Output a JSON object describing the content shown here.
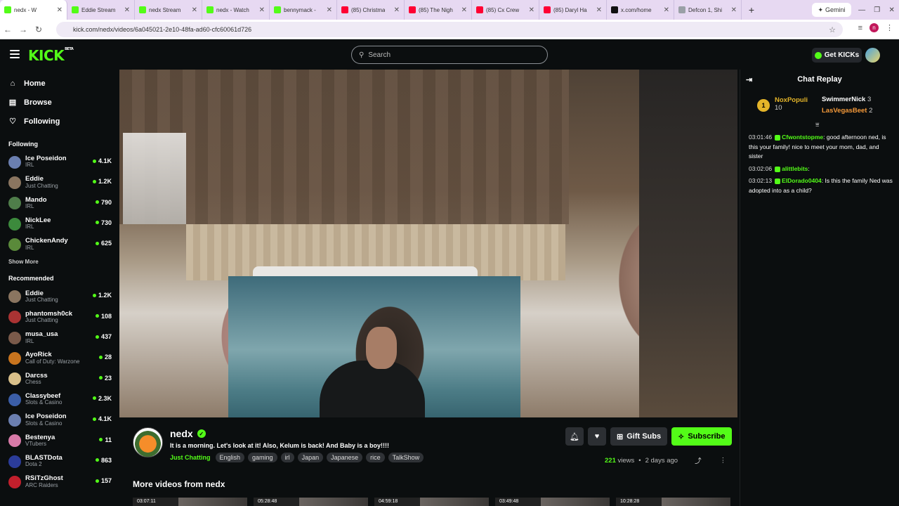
{
  "browser": {
    "tabs": [
      {
        "label": "nedx - W",
        "color": "#53fc18",
        "active": true
      },
      {
        "label": "Eddie Stream",
        "color": "#53fc18"
      },
      {
        "label": "nedx Stream",
        "color": "#53fc18"
      },
      {
        "label": "nedx - Watch",
        "color": "#53fc18"
      },
      {
        "label": "bennymack -",
        "color": "#53fc18"
      },
      {
        "label": "(85) Christma",
        "color": "#ff0033"
      },
      {
        "label": "(85) The Nigh",
        "color": "#ff0033"
      },
      {
        "label": "(85) Cx Crew",
        "color": "#ff0033"
      },
      {
        "label": "(85) Daryl Ha",
        "color": "#ff0033"
      },
      {
        "label": "x.com/home",
        "color": "#111111"
      },
      {
        "label": "Defcon 1, Shi",
        "color": "#9aa0a6"
      }
    ],
    "gemini_label": "Gemini",
    "url": "kick.com/nedx/videos/6a045021-2e10-48fa-ad60-cfc60061d726",
    "profile_initial": "n"
  },
  "header": {
    "logo": "KICK",
    "logo_sup": "BETA",
    "search_placeholder": "Search",
    "get_kicks": "Get KICKs"
  },
  "nav": [
    {
      "label": "Home",
      "icon": "home-icon",
      "glyph": "⌂"
    },
    {
      "label": "Browse",
      "icon": "browse-icon",
      "glyph": "▤"
    },
    {
      "label": "Following",
      "icon": "heart-icon",
      "glyph": "♡"
    }
  ],
  "following_title": "Following",
  "following": [
    {
      "name": "Ice Poseidon",
      "category": "IRL",
      "viewers": "4.1K",
      "color": "#6b7fb0"
    },
    {
      "name": "Eddie",
      "category": "Just Chatting",
      "viewers": "1.2K",
      "color": "#8a7560"
    },
    {
      "name": "Mando",
      "category": "IRL",
      "viewers": "790",
      "color": "#4f7d4a"
    },
    {
      "name": "NickLee",
      "category": "IRL",
      "viewers": "730",
      "color": "#3c8a3c"
    },
    {
      "name": "ChickenAndy",
      "category": "IRL",
      "viewers": "625",
      "color": "#5a8a3a"
    }
  ],
  "show_more": "Show More",
  "recommended_title": "Recommended",
  "recommended": [
    {
      "name": "Eddie",
      "category": "Just Chatting",
      "viewers": "1.2K",
      "color": "#8a7560"
    },
    {
      "name": "phantomsh0ck",
      "category": "Just Chatting",
      "viewers": "108",
      "color": "#a33"
    },
    {
      "name": "musa_usa",
      "category": "IRL",
      "viewers": "437",
      "color": "#7a5a4a"
    },
    {
      "name": "AyoRick",
      "category": "Call of Duty: Warzone",
      "viewers": "28",
      "color": "#c8741e"
    },
    {
      "name": "Darcss",
      "category": "Chess",
      "viewers": "23",
      "color": "#d9c08a"
    },
    {
      "name": "Classybeef",
      "category": "Slots & Casino",
      "viewers": "2.3K",
      "color": "#3b5ea8"
    },
    {
      "name": "Ice Poseidon",
      "category": "Slots & Casino",
      "viewers": "4.1K",
      "color": "#6b7fb0"
    },
    {
      "name": "Bestenya",
      "category": "VTubers",
      "viewers": "11",
      "color": "#d87aa8"
    },
    {
      "name": "BLASTDota",
      "category": "Dota 2",
      "viewers": "863",
      "color": "#2b3c9a"
    },
    {
      "name": "RSiTzGhost",
      "category": "ARC Raiders",
      "viewers": "157",
      "color": "#c21f2c"
    }
  ],
  "video": {
    "streamer": "nedx",
    "title": "It is a morning. Let's look at it! Also, Kelum is back! And Baby is a boy!!!!",
    "category": "Just Chatting",
    "tags": [
      "English",
      "gaming",
      "irl",
      "Japan",
      "Japanese",
      "rice",
      "TalkShow"
    ],
    "views": "221",
    "views_label": "views",
    "age": "2 days ago",
    "gift_subs": "Gift Subs",
    "subscribe": "Subscribe"
  },
  "more_videos_title": "More videos from nedx",
  "thumb_durations": [
    "03:07:11",
    "05:28:48",
    "04:59:18",
    "03:49:48",
    "10:28:28"
  ],
  "chat": {
    "title": "Chat Replay",
    "leaders": [
      {
        "name": "NoxPopuli",
        "count": "10",
        "color": "#e4b429"
      },
      {
        "name": "SwimmerNick",
        "count": "3",
        "color": "#ffffff"
      },
      {
        "name": "LasVegasBeet",
        "count": "2",
        "color": "#f59a3a"
      }
    ],
    "messages": [
      {
        "time": "03:01:46",
        "user": "Cfwontstopme",
        "color": "#53fc18",
        "text": "good afternoon ned, is this your family! nice to meet your mom, dad, and sister"
      },
      {
        "time": "03:02:06",
        "user": "alittlebits",
        "color": "#53fc18",
        "text": ""
      },
      {
        "time": "03:02:13",
        "user": "ElDorado0404",
        "color": "#53fc18",
        "text": "Is this the family Ned was adopted into as a child?"
      }
    ]
  }
}
